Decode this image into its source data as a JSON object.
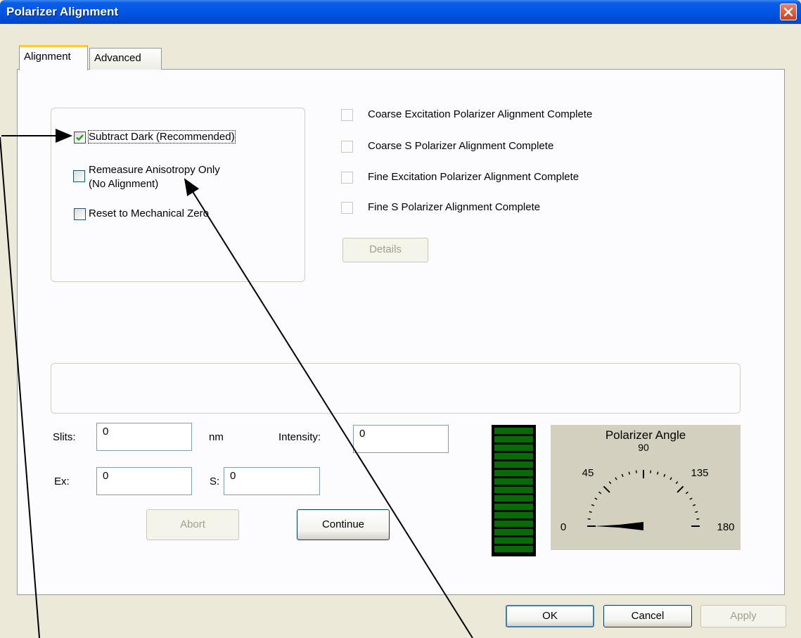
{
  "window": {
    "title": "Polarizer Alignment"
  },
  "tabs": [
    {
      "label": "Alignment",
      "active": true
    },
    {
      "label": "Advanced",
      "active": false
    }
  ],
  "options": [
    {
      "label": "Subtract Dark (Recommended)",
      "checked": true
    },
    {
      "label_line1": "Remeasure Anisotropy Only",
      "label_line2": "(No Alignment)",
      "checked": false
    },
    {
      "label": "Reset to Mechanical Zero",
      "checked": false
    }
  ],
  "status_items": [
    {
      "label": "Coarse Excitation Polarizer Alignment Complete",
      "checked": false
    },
    {
      "label": "Coarse S Polarizer Alignment Complete",
      "checked": false
    },
    {
      "label": "Fine Excitation Polarizer Alignment Complete",
      "checked": false
    },
    {
      "label": "Fine S Polarizer Alignment Complete",
      "checked": false
    }
  ],
  "details_label": "Details",
  "fields": {
    "slits_label": "Slits:",
    "slits_value": "0",
    "slits_unit": "nm",
    "intensity_label": "Intensity:",
    "intensity_value": "0",
    "ex_label": "Ex:",
    "ex_value": "0",
    "s_label": "S:",
    "s_value": "0"
  },
  "buttons": {
    "abort": "Abort",
    "continue": "Continue",
    "ok": "OK",
    "cancel": "Cancel",
    "apply": "Apply"
  },
  "gauge": {
    "title": "Polarizer Angle",
    "tick_0": "0",
    "tick_45": "45",
    "tick_90": "90",
    "tick_135": "135",
    "tick_180": "180",
    "angle_value": 0
  },
  "colors": {
    "titlebar": "#0054e3",
    "bar_segment": "#0a6a0a",
    "gauge_bg": "#d4d0c0"
  }
}
